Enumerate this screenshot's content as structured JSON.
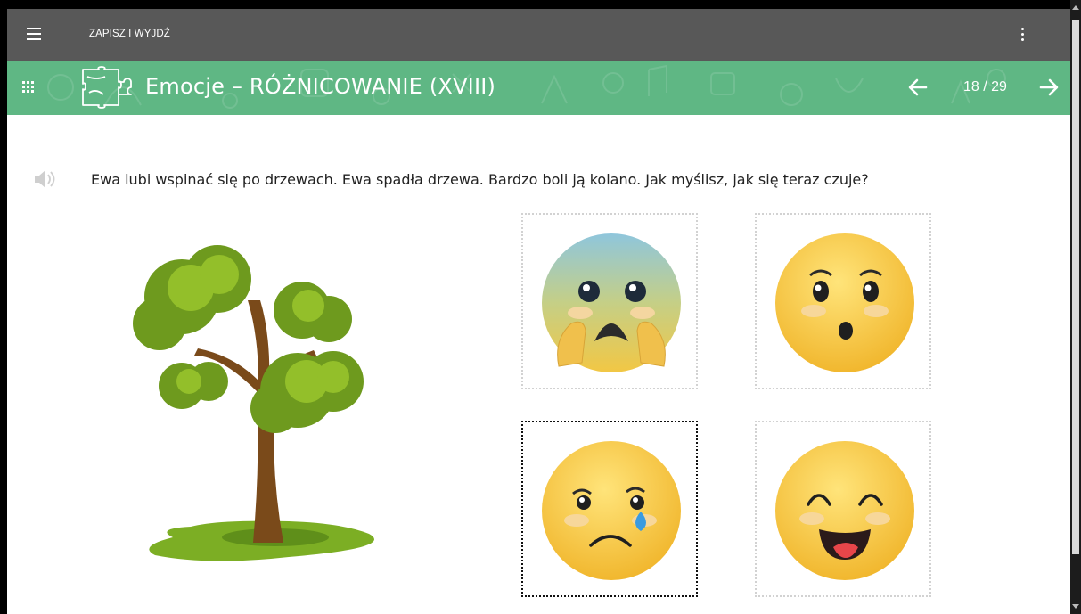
{
  "topbar": {
    "menu_icon": "hamburger-menu-icon",
    "save_exit_label": "ZAPISZ I WYJDŹ",
    "more_icon": "more-vertical-icon"
  },
  "header": {
    "apps_icon": "apps-grid-icon",
    "category_icon": "puzzle-icon",
    "title": "Emocje – RÓŻNICOWANIE (XVIII)",
    "prev_icon": "arrow-left-icon",
    "counter": "18 / 29",
    "next_icon": "arrow-right-icon",
    "colors": {
      "topbar": "#585858",
      "header": "#5fb784"
    }
  },
  "task": {
    "audio_icon": "speaker-icon",
    "question": "Ewa lubi wspinać się po drzewach. Ewa spadła drzewa. Bardzo boli ją kolano. Jak myślisz, jak się teraz czuje?",
    "illustration": "tree-illustration",
    "answers": [
      {
        "emotion": "scared",
        "selected": false
      },
      {
        "emotion": "surprised",
        "selected": false
      },
      {
        "emotion": "sad-crying",
        "selected": true
      },
      {
        "emotion": "happy",
        "selected": false
      }
    ]
  }
}
